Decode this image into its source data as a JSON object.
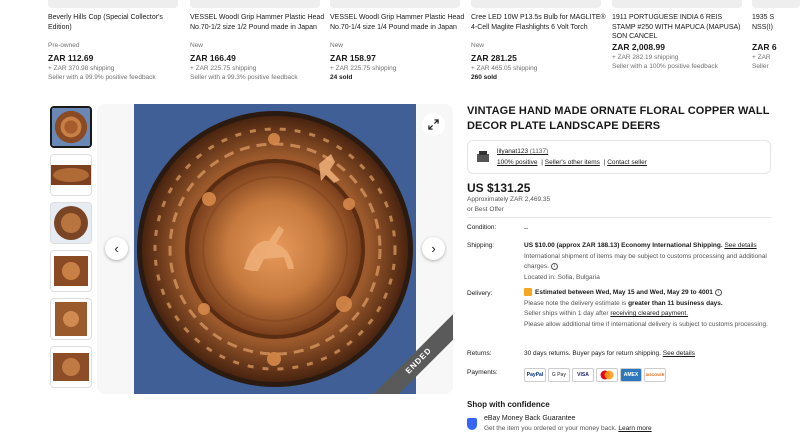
{
  "carousel": [
    {
      "title": "Beverly Hills Cop (Special Collector's Edition)",
      "condition": "Pre-owned",
      "price": "ZAR 112.69",
      "shipping": "+ ZAR 370.98 shipping",
      "extra": "Seller with a 99.9% positive feedback",
      "extra_bold": false
    },
    {
      "title": "VESSEL WoodI Grip Hammer Plastic Head No.70-1/2 size 1/2 Pound made in Japan",
      "condition": "New",
      "price": "ZAR 166.49",
      "shipping": "+ ZAR 225.75 shipping",
      "extra": "Seller with a 99.3% positive feedback",
      "extra_bold": false
    },
    {
      "title": "VESSEL WoodI Grip Hammer Plastic Head No.70-1/4 size 1/4 Pound made in Japan",
      "condition": "New",
      "price": "ZAR 158.97",
      "shipping": "+ ZAR 225.75 shipping",
      "extra": "24 sold",
      "extra_bold": true
    },
    {
      "title": "Cree LED 10W P13.5s Bulb for MAGLITE® 4-Cell Maglite Flashlights 6 Volt Torch",
      "condition": "New",
      "price": "ZAR 281.25",
      "shipping": "+ ZAR 465.05 shipping",
      "extra": "260 sold",
      "extra_bold": true
    },
    {
      "title": "1911 PORTUGUESE INDIA 6 REIS STAMP #250 WITH MAPUCA (MAPUSA) SON CANCEL",
      "condition": "",
      "price": "ZAR 2,008.99",
      "shipping": "+ ZAR 282.19 shipping",
      "extra": "Seller with a 100% positive feedback",
      "extra_bold": false
    },
    {
      "title": "1935 S NSS(I)",
      "condition": "",
      "price": "ZAR 6",
      "shipping": "+ ZAR",
      "extra": "Seller",
      "extra_bold": false
    }
  ],
  "listing": {
    "title": "VINTAGE HAND MADE ORNATE FLORAL COPPER WALL DECOR PLATE LANDSCAPE DEERS",
    "ended_label": "ENDED",
    "seller": {
      "name": "lilyanat123",
      "count": "(1137)",
      "positive": "100% positive",
      "other_items": "Seller's other items",
      "contact": "Contact seller"
    },
    "price": "US $131.25",
    "approx": "Approximately ZAR 2,469.35",
    "best_offer": "or Best Offer",
    "condition_label": "Condition:",
    "condition_value": "--",
    "shipping_label": "Shipping:",
    "shipping_main": "US $10.00 (approx ZAR 188.13) Economy International Shipping.",
    "shipping_link": "See details",
    "shipping_note": "International shipment of items may be subject to customs processing and additional charges.",
    "located": "Located in: Sofia, Bulgaria",
    "delivery_label": "Delivery:",
    "delivery_est": "Estimated between Wed, May 15 and Wed, May 29 to 4001",
    "delivery_note1a": "Please note the delivery estimate is",
    "delivery_note1b": "greater than 11 business days.",
    "delivery_note2a": "Seller ships within 1 day after",
    "delivery_note2b": "receiving cleared payment.",
    "delivery_note3": "Please allow additional time if international delivery is subject to customs processing.",
    "returns_label": "Returns:",
    "returns_value": "30 days returns. Buyer pays for return shipping.",
    "returns_link": "See details",
    "payments_label": "Payments:",
    "payments": [
      "PayPal",
      "G Pay",
      "VISA",
      "MC",
      "AMEX",
      "DISCOVER"
    ],
    "confidence_title": "Shop with confidence",
    "guarantee_title": "eBay Money Back Guarantee",
    "guarantee_sub": "Get the item you ordered or your money back.",
    "guarantee_link": "Learn more"
  },
  "colors": {
    "accent": "#3665f3",
    "plate_bg": "#3f5f96",
    "copper": "#b8703a"
  }
}
